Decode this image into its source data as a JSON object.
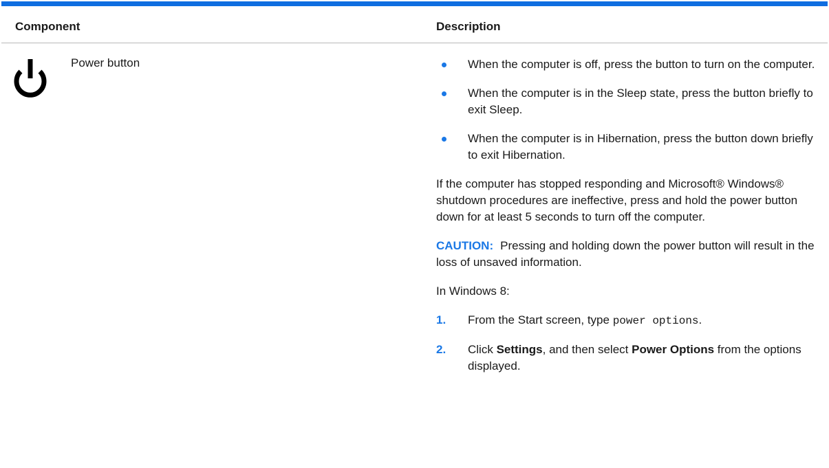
{
  "table": {
    "header": {
      "component": "Component",
      "description": "Description"
    },
    "row": {
      "icon": "power-icon",
      "component_name": "Power button",
      "bullets": [
        "When the computer is off, press the button to turn on the computer.",
        "When the computer is in the Sleep state, press the button briefly to exit Sleep.",
        "When the computer is in Hibernation, press the button down briefly to exit Hibernation."
      ],
      "paragraph": "If the computer has stopped responding and Microsoft® Windows® shutdown procedures are ineffective, press and hold the power button down for at least 5 seconds to turn off the computer.",
      "caution": {
        "label": "CAUTION:",
        "text": "Pressing and holding down the power button will result in the loss of unsaved information."
      },
      "windows_intro": "In Windows 8:",
      "steps": [
        {
          "number": "1.",
          "before": "From the Start screen, type ",
          "code": "power options",
          "after": "."
        },
        {
          "number": "2.",
          "before": "Click ",
          "bold1": "Settings",
          "middle": ", and then select ",
          "bold2": "Power Options",
          "after": " from the options displayed."
        }
      ]
    }
  },
  "colors": {
    "accent": "#1a78e6",
    "rule": "#0f6ee0",
    "text": "#1a1a1a"
  }
}
